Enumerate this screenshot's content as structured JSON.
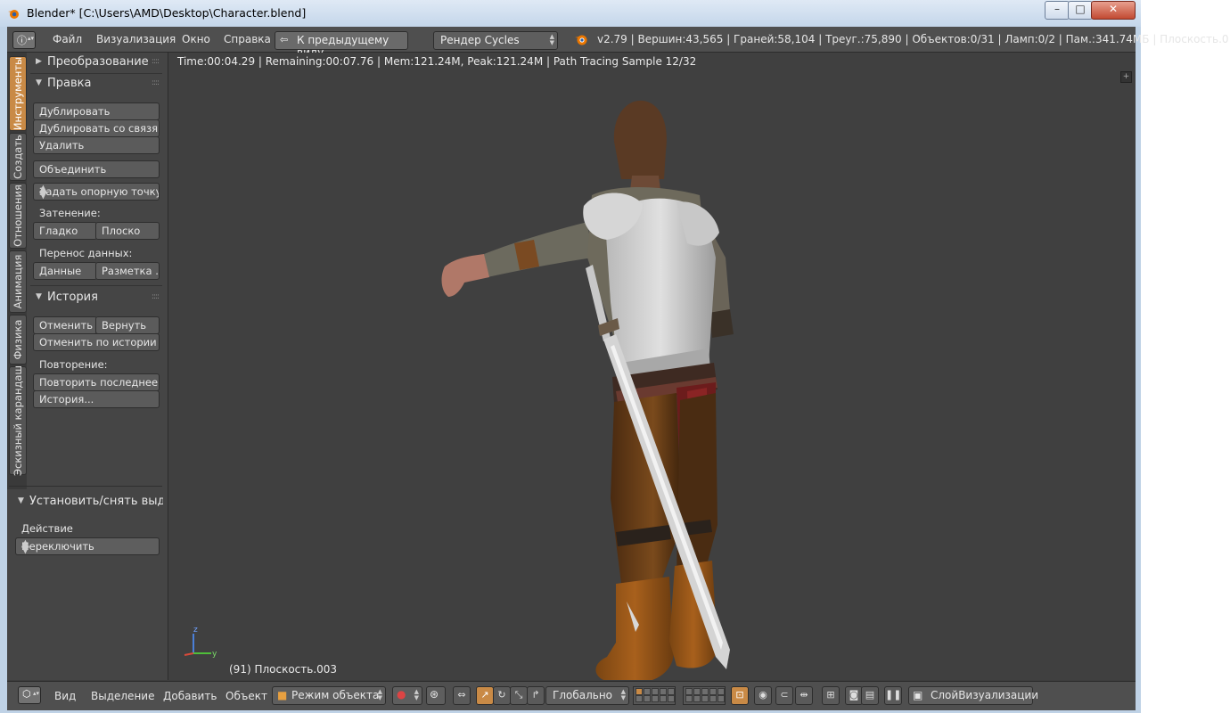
{
  "window": {
    "title": "Blender* [C:\\Users\\AMD\\Desktop\\Character.blend]",
    "minimize_label": "–",
    "maximize_label": "□",
    "close_label": "✕"
  },
  "menubar": {
    "editor_icon": "info-icon",
    "items": [
      "Файл",
      "Визуализация",
      "Окно",
      "Справка"
    ],
    "back_label": "К предыдущему виду",
    "render_engine": "Рендер Cycles",
    "stats": "v2.79 | Вершин:43,565 | Граней:58,104 | Треуг.:75,890 | Объектов:0/31 | Ламп:0/2 | Пам.:341.74МБ | Плоскость.0"
  },
  "tool_tabs": [
    "Инструменты",
    "Создать",
    "Отношения",
    "Анимация",
    "Физика",
    "Эскизный карандаш"
  ],
  "tool_shelf": {
    "transform_header": "Преобразование",
    "edit_header": "Правка",
    "duplicate": "Дублировать",
    "duplicate_linked": "Дублировать со связя...",
    "delete": "Удалить",
    "join": "Объединить",
    "set_origin": "Задать опорную точку",
    "shading_label": "Затенение:",
    "smooth": "Гладко",
    "flat": "Плоско",
    "data_transfer_label": "Перенос данных:",
    "data": "Данные",
    "layout": "Разметка ...",
    "history_header": "История",
    "undo": "Отменить",
    "redo": "Вернуть",
    "undo_history": "Отменить по истории",
    "repeat_label": "Повторение:",
    "repeat_last": "Повторить последнее",
    "history": "История...",
    "operator_header": "Установить/снять выделе",
    "action_label": "Действие",
    "action_value": "Переключить"
  },
  "viewport": {
    "render_status": "Time:00:04.29 | Remaining:00:07.76 | Mem:121.24M, Peak:121.24M | Path Tracing Sample 12/32",
    "object_label": "(91) Плоскость.003",
    "axis_z": "z",
    "axis_y": "y"
  },
  "bottombar": {
    "items": [
      "Вид",
      "Выделение",
      "Добавить",
      "Объект"
    ],
    "mode": "Режим объекта",
    "orientation": "Глобально",
    "render_layer": "СлойВизуализации"
  },
  "colors": {
    "accent": "#c98a46",
    "background": "#404040",
    "header": "#4f4f4f",
    "panel": "#454545"
  }
}
